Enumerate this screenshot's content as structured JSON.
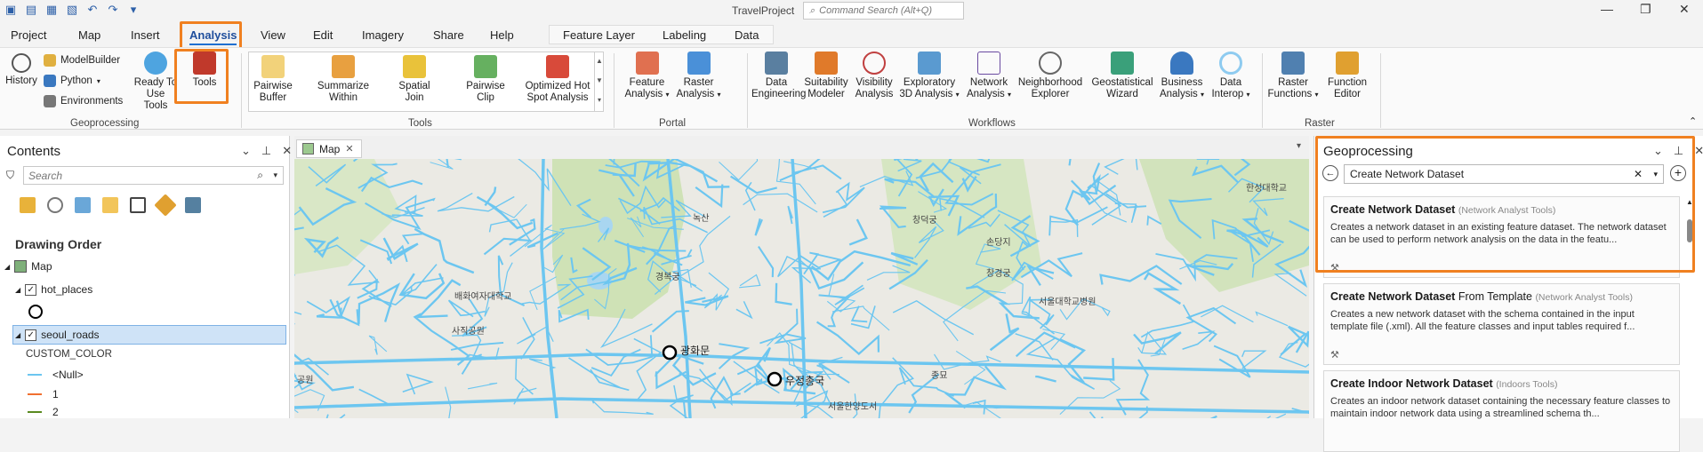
{
  "app": {
    "title": "TravelProject",
    "command_search_placeholder": "Command Search (Alt+Q)"
  },
  "tabs": [
    "Project",
    "Map",
    "Insert",
    "Analysis",
    "View",
    "Edit",
    "Imagery",
    "Share",
    "Help"
  ],
  "context_tabs": [
    "Feature Layer",
    "Labeling",
    "Data"
  ],
  "ribbon": {
    "geoprocessing": {
      "label": "Geoprocessing",
      "history": "History",
      "modelbuilder": "ModelBuilder",
      "python": "Python",
      "environments": "Environments",
      "ready_to_use": "Ready To Use Tools",
      "tools": "Tools"
    },
    "tools_group": {
      "label": "Tools",
      "items": [
        "Pairwise Buffer",
        "Summarize Within",
        "Spatial Join",
        "Pairwise Clip",
        "Optimized Hot Spot Analysis"
      ]
    },
    "portal": {
      "label": "Portal",
      "items": [
        "Feature Analysis",
        "Raster Analysis"
      ]
    },
    "workflows": {
      "label": "Workflows",
      "items": [
        "Data Engineering",
        "Suitability Modeler",
        "Visibility Analysis",
        "Exploratory 3D Analysis",
        "Network Analysis",
        "Neighborhood Explorer",
        "Geostatistical Wizard",
        "Business Analysis",
        "Data Interop"
      ]
    },
    "raster": {
      "label": "Raster",
      "items": [
        "Raster Functions",
        "Function Editor"
      ]
    }
  },
  "contents": {
    "title": "Contents",
    "search_placeholder": "Search",
    "drawing_order": "Drawing Order",
    "map": "Map",
    "layer1": "hot_places",
    "layer2": "seoul_roads",
    "field": "CUSTOM_COLOR",
    "legend": [
      {
        "label": "<Null>",
        "color": "#6cc6f0"
      },
      {
        "label": "1",
        "color": "#f07030"
      },
      {
        "label": "2",
        "color": "#5a8a20"
      }
    ]
  },
  "map_view": {
    "tab": "Map",
    "labels": [
      "녹산",
      "창덕궁",
      "손당지",
      "경복궁",
      "창경궁",
      "서울대학교병원",
      "배화여자대학교",
      "사직공원",
      "광화문",
      "우정총국",
      "종묘",
      "한성대학교",
      "공원",
      "서울한양도서"
    ],
    "points": [
      "광화문",
      "우정총국"
    ]
  },
  "geoprocessing": {
    "title": "Geoprocessing",
    "search_value": "Create Network Dataset",
    "results": [
      {
        "t1": "Create Network Dataset",
        "t2": "",
        "src": "(Network Analyst Tools)",
        "desc": "Creates a network dataset in an existing feature dataset. The network dataset can be used to perform network analysis on the data in the featu..."
      },
      {
        "t1": "Create Network Dataset",
        "t2": " From Template",
        "src": "(Network Analyst Tools)",
        "desc": "Creates a new network dataset with the schema contained in the input template file (.xml). All the feature classes and input tables required f..."
      },
      {
        "t1": "Create",
        "t2": " Indoor Network Dataset",
        "src": "(Indoors Tools)",
        "desc": "Creates an indoor network dataset containing the necessary feature classes to maintain indoor network data using a streamlined schema th..."
      }
    ]
  },
  "colors": {
    "accent": "#1f6fd0",
    "highlight": "#f08020",
    "road": "#6cc6f0",
    "park": "#cfe2b6"
  }
}
